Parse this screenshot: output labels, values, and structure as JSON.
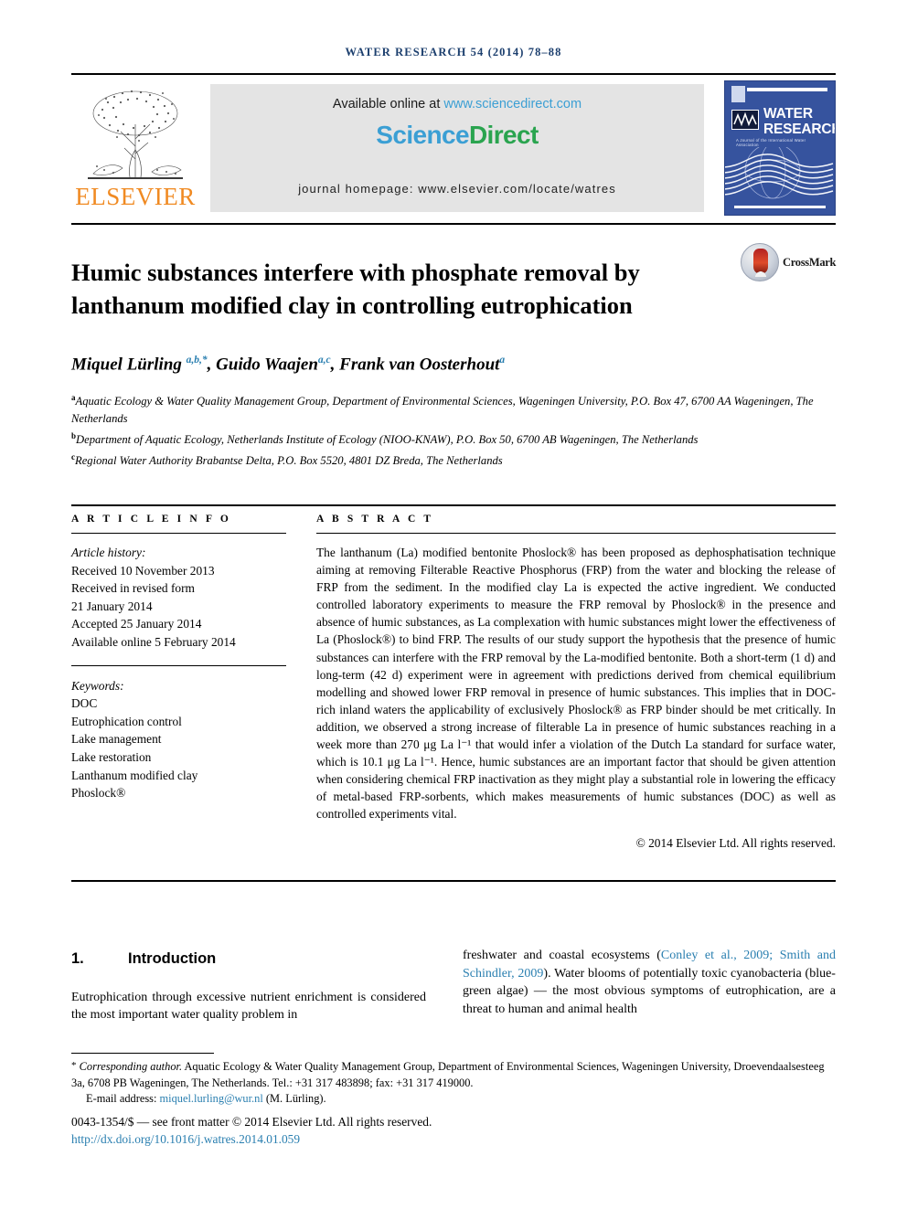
{
  "running_head": "WATER RESEARCH 54 (2014) 78–88",
  "masthead": {
    "publisher_name": "ELSEVIER",
    "available_prefix": "Available online at ",
    "available_url": "www.sciencedirect.com",
    "brand_part1": "Science",
    "brand_part2": "Direct",
    "journal_homepage": "journal homepage: www.elsevier.com/locate/watres",
    "cover": {
      "line1": "WATER",
      "line2": "RESEARCH",
      "subtitle": "A Journal of the International Water Association",
      "society_logo": "IWA"
    }
  },
  "article": {
    "title": "Humic substances interfere with phosphate removal by lanthanum modified clay in controlling eutrophication",
    "crossmark_label": "CrossMark",
    "authors_html": "Miquel Lürling <sup>a,b,*</sup>, Guido Waajen<sup>a,c</sup>, Frank van Oosterhout<sup>a</sup>",
    "affiliations": [
      {
        "marker": "a",
        "text": "Aquatic Ecology & Water Quality Management Group, Department of Environmental Sciences, Wageningen University, P.O. Box 47, 6700 AA Wageningen, The Netherlands"
      },
      {
        "marker": "b",
        "text": "Department of Aquatic Ecology, Netherlands Institute of Ecology (NIOO-KNAW), P.O. Box 50, 6700 AB Wageningen, The Netherlands"
      },
      {
        "marker": "c",
        "text": "Regional Water Authority Brabantse Delta, P.O. Box 5520, 4801 DZ Breda, The Netherlands"
      }
    ]
  },
  "article_info": {
    "heading": "A R T I C L E   I N F O",
    "history_label": "Article history:",
    "history": [
      "Received 10 November 2013",
      "Received in revised form",
      "21 January 2014",
      "Accepted 25 January 2014",
      "Available online 5 February 2014"
    ],
    "keywords_label": "Keywords:",
    "keywords": [
      "DOC",
      "Eutrophication control",
      "Lake management",
      "Lake restoration",
      "Lanthanum modified clay",
      "Phoslock®"
    ]
  },
  "abstract": {
    "heading": "A B S T R A C T",
    "text": "The lanthanum (La) modified bentonite Phoslock® has been proposed as dephosphatisation technique aiming at removing Filterable Reactive Phosphorus (FRP) from the water and blocking the release of FRP from the sediment. In the modified clay La is expected the active ingredient. We conducted controlled laboratory experiments to measure the FRP removal by Phoslock® in the presence and absence of humic substances, as La complexation with humic substances might lower the effectiveness of La (Phoslock®) to bind FRP. The results of our study support the hypothesis that the presence of humic substances can interfere with the FRP removal by the La-modified bentonite. Both a short-term (1 d) and long-term (42 d) experiment were in agreement with predictions derived from chemical equilibrium modelling and showed lower FRP removal in presence of humic substances. This implies that in DOC-rich inland waters the applicability of exclusively Phoslock® as FRP binder should be met critically. In addition, we observed a strong increase of filterable La in presence of humic substances reaching in a week more than 270 μg La l⁻¹ that would infer a violation of the Dutch La standard for surface water, which is 10.1 μg La l⁻¹. Hence, humic substances are an important factor that should be given attention when considering chemical FRP inactivation as they might play a substantial role in lowering the efficacy of metal-based FRP-sorbents, which makes measurements of humic substances (DOC) as well as controlled experiments vital.",
    "copyright": "© 2014 Elsevier Ltd. All rights reserved."
  },
  "introduction": {
    "section_number": "1.",
    "section_title": "Introduction",
    "left_text": "Eutrophication through excessive nutrient enrichment is considered the most important water quality problem in",
    "right_text_part1": "freshwater and coastal ecosystems (",
    "right_citation1": "Conley et al., 2009; Smith and Schindler, 2009",
    "right_text_part2": "). Water blooms of potentially toxic cyanobacteria (blue-green algae) — the most obvious symptoms of eutrophication, are a threat to human and animal health"
  },
  "footnote": {
    "star": "*",
    "corresponding_label": "Corresponding author.",
    "corresponding_text": " Aquatic Ecology & Water Quality Management Group, Department of Environmental Sciences, Wageningen University, Droevendaalsesteeg 3a, 6708 PB Wageningen, The Netherlands. Tel.: +31 317 483898; fax: +31 317 419000.",
    "email_label": "E-mail address: ",
    "email": "miquel.lurling@wur.nl",
    "email_suffix": " (M. Lürling)."
  },
  "imprint": {
    "issn_line": "0043-1354/$ — see front matter © 2014 Elsevier Ltd. All rights reserved.",
    "doi": "http://dx.doi.org/10.1016/j.watres.2014.01.059"
  },
  "colors": {
    "link": "#2a7fb0",
    "elsevier_orange": "#f08a22",
    "sciencedirect_blue": "#3b9fd4",
    "sciencedirect_green": "#2aa44f",
    "cover_blue": "#36539e",
    "running_head": "#1c3f6e"
  }
}
